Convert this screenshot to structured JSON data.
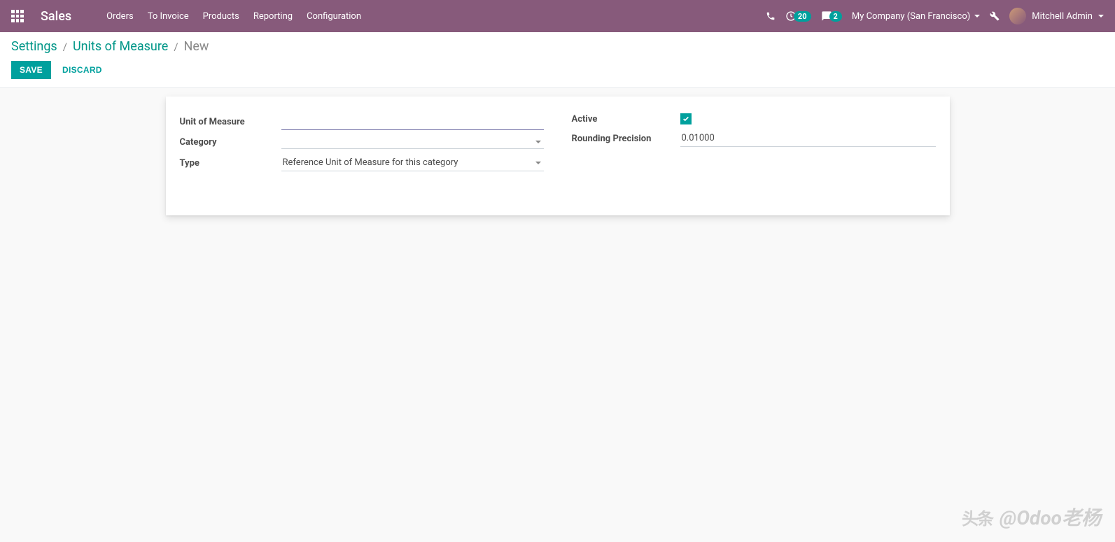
{
  "navbar": {
    "app_title": "Sales",
    "menu": [
      "Orders",
      "To Invoice",
      "Products",
      "Reporting",
      "Configuration"
    ],
    "activities_count": "20",
    "messages_count": "2",
    "company_name": "My Company (San Francisco)",
    "user_name": "Mitchell Admin"
  },
  "breadcrumb": {
    "items": [
      "Settings",
      "Units of Measure"
    ],
    "current": "New"
  },
  "buttons": {
    "save": "SAVE",
    "discard": "DISCARD"
  },
  "form": {
    "left": {
      "uom_label": "Unit of Measure",
      "uom_value": "",
      "category_label": "Category",
      "category_value": "",
      "type_label": "Type",
      "type_value": "Reference Unit of Measure for this category"
    },
    "right": {
      "active_label": "Active",
      "active_checked": true,
      "rounding_label": "Rounding Precision",
      "rounding_value": "0.01000"
    }
  },
  "watermark": {
    "brand": "头条",
    "text": "@Odoo老杨"
  }
}
